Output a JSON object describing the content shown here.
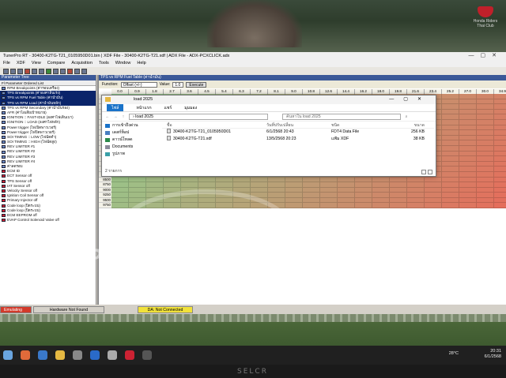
{
  "app": {
    "title": "TunerPro RT - 30400-K2TG-T21_0105950D01.bin | XDF File - 30400-K2TG-T21.xdf | ADX File - ADX-PCXCLICK.adx",
    "menu": [
      "File",
      "XDF",
      "View",
      "Compare",
      "Acquisition",
      "Tools",
      "Window",
      "Help"
    ],
    "status": {
      "emulating": "Emulating",
      "hardware": "Hardware Not Found",
      "da": "DA: Not Connected"
    }
  },
  "param_tree": {
    "header": "Parameter Tree",
    "filter": "Fl Parameter Ordered List",
    "items": [
      "RPM Breakpoints (ค่ารอบเครื่อง)",
      "TPS Breakpoints (ค่าองศาลิ้นเร่ง)",
      "TPS vs RPM Fuel Table (ค่าน้ำมัน)",
      "TPS vs RPM Load (ค่าน้ำมันหลัก)",
      "TPS vs RPM Secondary (ค่าน้ำมันรอง)",
      "AFR (ค่าไอเสียเป้าหมาย)",
      "IGNITION :: FAST-IDLE (องศาไฟเดินเบา)",
      "IGNITION :: LOAD (องศาไฟหลัก)",
      "Power trigger (ไฟเปิดพาวเวอร์)",
      "Power trigger (ไฟปิดพาวเวอร์)",
      "SOI TIMING :: LOW (ไฟฉีดต่ำ)",
      "SOI TIMING :: HIGH (ไฟฉีดสูง)",
      "REV LIMITER #1",
      "REV LIMITER #2",
      "REV LIMITER #3",
      "REV LIMITER #4",
      "ค่าลดรอบ",
      "ECM ID",
      "ECT Sensor off",
      "TPS Sensor off",
      "IAT Sensor off",
      "Velocity Sensor off",
      "Ignition Coil Sensor off",
      "Primary Injector off",
      "Code loop (ปิดระบบ)",
      "Code loop (ปิดระบบ)",
      "ECM EEPROM off",
      "EVAP Control Solenoid Valve off"
    ]
  },
  "map_window": {
    "title": "TPS vs RPM Fuel Table (ค่าน้ำมัน)",
    "function_label": "Function:",
    "function_value": "Offset (+/-)",
    "value_label": "Value:",
    "value": "1.0",
    "execute": "Execute",
    "col_headers": [
      "0.0",
      "0.9",
      "1.8",
      "2.7",
      "3.6",
      "4.5",
      "5.4",
      "6.3",
      "7.2",
      "8.1",
      "9.0",
      "10.8",
      "12.6",
      "14.4",
      "16.2",
      "18.0",
      "19.8",
      "21.6",
      "23.4",
      "25.2",
      "27.0",
      "30.0",
      "34.9",
      "40.0"
    ],
    "rpm": [
      "4050",
      "4500",
      "5000",
      "5250",
      "5500",
      "5750",
      "6000",
      "6250",
      "6500",
      "6750",
      "7000",
      "7250",
      "7500",
      "7750",
      "8000",
      "8250",
      "8500",
      "8750",
      "9000",
      "9250",
      "9500",
      "9750"
    ],
    "top_right_values": [
      "30.0",
      "34.9",
      "40.0"
    ]
  },
  "file_dialog": {
    "title": "load 2025",
    "tabs": [
      "ไฟล์",
      "หน้าแรก",
      "แชร์",
      "มุมมอง"
    ],
    "address": "load 2025",
    "search_placeholder": "ค้นหาใน load 2025",
    "nav_items": [
      "การเข้าถึงด่วน",
      "เดสก์ท็อป",
      "ดาวน์โหลด",
      "Documents",
      "รูปภาพ"
    ],
    "columns": {
      "name": "ชื่อ",
      "date": "วันที่ปรับเปลี่ยน",
      "type": "ชนิด",
      "size": "ขนาด"
    },
    "files": [
      {
        "name": "30400-K2TG-T21_0105950D01",
        "date": "6/1/2568 20:43",
        "type": "FDT4 Data File",
        "size": "256 KB"
      },
      {
        "name": "30400-K2TG-T21.xdf",
        "date": "13/5/2568 20:23",
        "type": "แฟ้ม XDF",
        "size": "38 KB"
      }
    ],
    "item_count": "2 รายการ"
  },
  "watermark": {
    "big": "SUPER",
    "small": "Lampang"
  },
  "brand": {
    "name": "Honda Riders Thai Club"
  },
  "taskbar": {
    "temp": "28°C",
    "time": "20:31",
    "date": "6/1/2568"
  },
  "bezel": {
    "brand": "SELCR"
  },
  "colors": {
    "accent": "#3b5998",
    "selection": "#0a246a",
    "emulating": "#d23a2a",
    "da_status": "#f1e13a",
    "cell_green": "#8fd08f",
    "cell_red": "#e86a5a"
  }
}
